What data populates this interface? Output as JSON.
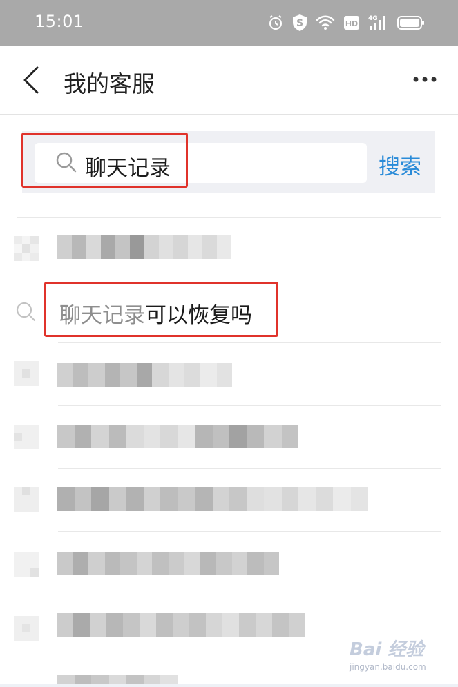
{
  "status_bar": {
    "time": "15:01",
    "icons": [
      "alarm-icon",
      "shield-s-icon",
      "wifi-icon",
      "hd-icon",
      "signal-4g-icon",
      "battery-icon"
    ],
    "hd_label": "HD",
    "network_label": "4G"
  },
  "header": {
    "title": "我的客服",
    "back_icon": "chevron-left-icon",
    "more_icon": "more-dots-icon"
  },
  "search": {
    "query": "聊天记录",
    "button_label": "搜索",
    "highlight_color": "#e0332b",
    "accent_color": "#2a8bd8"
  },
  "suggestion": {
    "match_text": "聊天记录",
    "rest_text": "可以恢复吗"
  },
  "watermark": {
    "logo": "Bai 经验",
    "url": "jingyan.baidu.com"
  }
}
